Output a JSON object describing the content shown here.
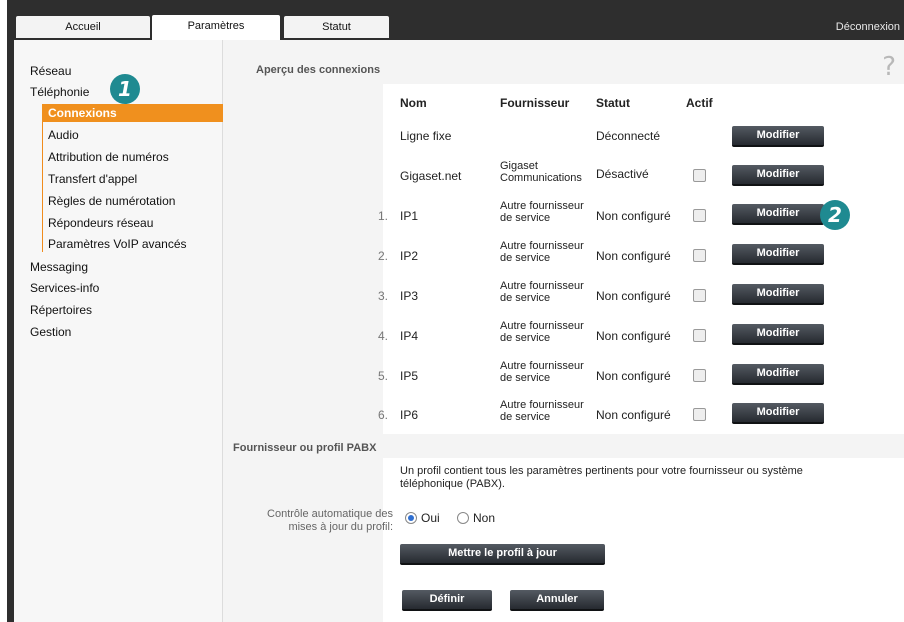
{
  "tabs": [
    {
      "label": "Accueil",
      "active": false
    },
    {
      "label": "Paramètres",
      "active": true
    },
    {
      "label": "Statut",
      "active": false
    }
  ],
  "logout_label": "Déconnexion",
  "sidebar": {
    "items": [
      {
        "label": "Réseau"
      },
      {
        "label": "Téléphonie"
      },
      {
        "label": "Messaging"
      },
      {
        "label": "Services-info"
      },
      {
        "label": "Répertoires"
      },
      {
        "label": "Gestion"
      }
    ],
    "telephony_sub": [
      {
        "label": "Connexions",
        "active": true
      },
      {
        "label": "Audio"
      },
      {
        "label": "Attribution de numéros"
      },
      {
        "label": "Transfert d'appel"
      },
      {
        "label": "Règles de numérotation"
      },
      {
        "label": "Répondeurs réseau"
      },
      {
        "label": "Paramètres VoIP avancés"
      }
    ]
  },
  "badges": {
    "one": "1",
    "two": "2"
  },
  "help_icon": "?",
  "overview": {
    "title": "Aperçu des connexions",
    "headers": {
      "name": "Nom",
      "provider": "Fournisseur",
      "status": "Statut",
      "active": "Actif"
    },
    "rows": [
      {
        "num": "",
        "name": "Ligne fixe",
        "provider_1": "",
        "provider_2": "",
        "status": "Déconnecté",
        "checkbox": false,
        "button": "Modifier"
      },
      {
        "num": "",
        "name": "Gigaset.net",
        "provider_1": "Gigaset",
        "provider_2": "Communications",
        "status": "Désactivé",
        "checkbox": true,
        "button": "Modifier"
      },
      {
        "num": "1.",
        "name": "IP1",
        "provider_1": "Autre fournisseur",
        "provider_2": "de service",
        "status": "Non configuré",
        "checkbox": true,
        "button": "Modifier"
      },
      {
        "num": "2.",
        "name": "IP2",
        "provider_1": "Autre fournisseur",
        "provider_2": "de service",
        "status": "Non configuré",
        "checkbox": true,
        "button": "Modifier"
      },
      {
        "num": "3.",
        "name": "IP3",
        "provider_1": "Autre fournisseur",
        "provider_2": "de service",
        "status": "Non configuré",
        "checkbox": true,
        "button": "Modifier"
      },
      {
        "num": "4.",
        "name": "IP4",
        "provider_1": "Autre fournisseur",
        "provider_2": "de service",
        "status": "Non configuré",
        "checkbox": true,
        "button": "Modifier"
      },
      {
        "num": "5.",
        "name": "IP5",
        "provider_1": "Autre fournisseur",
        "provider_2": "de service",
        "status": "Non configuré",
        "checkbox": true,
        "button": "Modifier"
      },
      {
        "num": "6.",
        "name": "IP6",
        "provider_1": "Autre fournisseur",
        "provider_2": "de service",
        "status": "Non configuré",
        "checkbox": true,
        "button": "Modifier"
      }
    ]
  },
  "profile": {
    "title": "Fournisseur ou profil PABX",
    "description_1": "Un profil contient tous les paramètres pertinents pour votre fournisseur ou système",
    "description_2": "téléphonique (PABX).",
    "auto_label_1": "Contrôle automatique des",
    "auto_label_2": "mises à jour du profil:",
    "option_yes": "Oui",
    "option_no": "Non",
    "selected": "Oui",
    "update_button": "Mettre le profil à jour"
  },
  "actions": {
    "define": "Définir",
    "cancel": "Annuler"
  }
}
